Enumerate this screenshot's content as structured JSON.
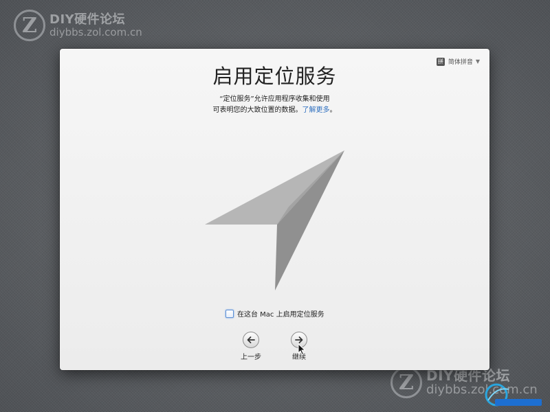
{
  "watermarks": {
    "top": {
      "logo": "Z",
      "title": "DIY硬件论坛",
      "url": "diybbs.zol.com.cn"
    },
    "bottom": {
      "logo": "Z",
      "title": "DIY硬件论坛",
      "url": "diybbs.zol.com.cn"
    }
  },
  "language_menu": {
    "icon": "拼",
    "label": "简体拼音"
  },
  "title": "启用定位服务",
  "description": {
    "line1": "“定位服务”允许应用程序收集和使用",
    "line2": "可表明您的大致位置的数据。",
    "link": "了解更多"
  },
  "checkbox": {
    "label": "在这台 Mac 上启用定位服务",
    "checked": false
  },
  "buttons": {
    "back": "上一步",
    "continue": "继续"
  },
  "colors": {
    "link": "#2e6fbf",
    "checkbox_focus": "#5b8fd6",
    "arrow_light": "#b4b4b4",
    "arrow_dark": "#8e8e8e"
  },
  "icons": {
    "location": "location-arrow-icon",
    "back": "back-arrow-icon",
    "forward": "forward-arrow-icon",
    "cursor": "mouse-pointer-icon",
    "input_method": "pinyin-input-icon"
  }
}
